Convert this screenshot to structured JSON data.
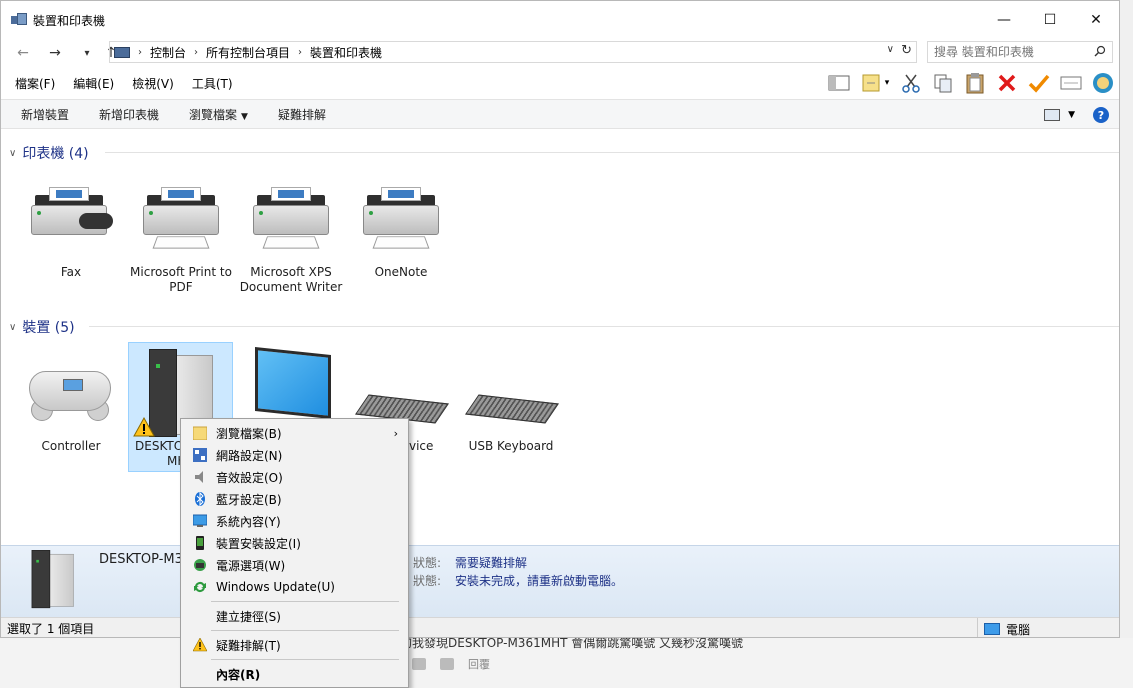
{
  "window": {
    "title": "裝置和印表機",
    "controls": {
      "minimize": "—",
      "maximize": "☐",
      "close": "✕"
    }
  },
  "address": {
    "back": "←",
    "forward": "→",
    "up": "↑",
    "breadcrumbs": [
      "控制台",
      "所有控制台項目",
      "裝置和印表機"
    ],
    "search_placeholder": "搜尋 裝置和印表機"
  },
  "menubar": [
    "檔案(F)",
    "編輯(E)",
    "檢視(V)",
    "工具(T)"
  ],
  "toolbar_icons": [
    "layout-icon",
    "folder-note-icon",
    "cut-icon",
    "copy-icon",
    "paste-icon",
    "delete-icon",
    "check-icon",
    "mail-icon",
    "shell-icon"
  ],
  "commandbar": {
    "add_device": "新增裝置",
    "add_printer": "新增印表機",
    "browse_files": "瀏覽檔案",
    "troubleshoot": "疑難排解"
  },
  "groups": {
    "printers": {
      "label": "印表機 (4)"
    },
    "devices": {
      "label": "裝置 (5)"
    }
  },
  "printers": [
    {
      "name": "Fax"
    },
    {
      "name": "Microsoft Print to PDF"
    },
    {
      "name": "Microsoft XPS Document Writer"
    },
    {
      "name": "OneNote"
    }
  ],
  "devices": [
    {
      "name": "Controller"
    },
    {
      "name": "DESKTOP-M361MHT",
      "visible": "DESKTO",
      "visible2": "MH"
    },
    {
      "name": "",
      "visible": "vice"
    },
    {
      "name": "USB Keyboard"
    }
  ],
  "details": {
    "name": "DESKTOP-M3",
    "status_key_1": "狀態:",
    "status_val_1": "需要疑難排解",
    "status_key_2": "狀態:",
    "status_val_2": "安裝未完成，請重新啟動電腦。"
  },
  "statusbar": {
    "selected": "選取了 1 個項目",
    "computer": "電腦"
  },
  "context_menu": [
    {
      "label": "瀏覽檔案(B)",
      "icon": "folder-icon",
      "has_sub": true
    },
    {
      "label": "網路設定(N)",
      "icon": "network-icon"
    },
    {
      "label": "音效設定(O)",
      "icon": "speaker-icon"
    },
    {
      "label": "藍牙設定(B)",
      "icon": "bluetooth-icon"
    },
    {
      "label": "系統內容(Y)",
      "icon": "system-icon"
    },
    {
      "label": "裝置安裝設定(I)",
      "icon": "phone-icon"
    },
    {
      "label": "電源選項(W)",
      "icon": "power-icon"
    },
    {
      "label": "Windows Update(U)",
      "icon": "update-icon"
    },
    {
      "label": "建立捷徑(S)",
      "icon": ""
    },
    {
      "label": "疑難排解(T)",
      "icon": "warning-icon"
    },
    {
      "label": "內容(R)",
      "icon": ""
    }
  ],
  "background": {
    "post_text": "的我發現DESKTOP-M361MHT 會偶爾跳驚嘆號 又幾秒沒驚嘆號",
    "reply": "回覆"
  },
  "colors": {
    "group_header": "#1e3287",
    "selection": "#cce8ff",
    "details_bg": "#dbe7f4"
  }
}
